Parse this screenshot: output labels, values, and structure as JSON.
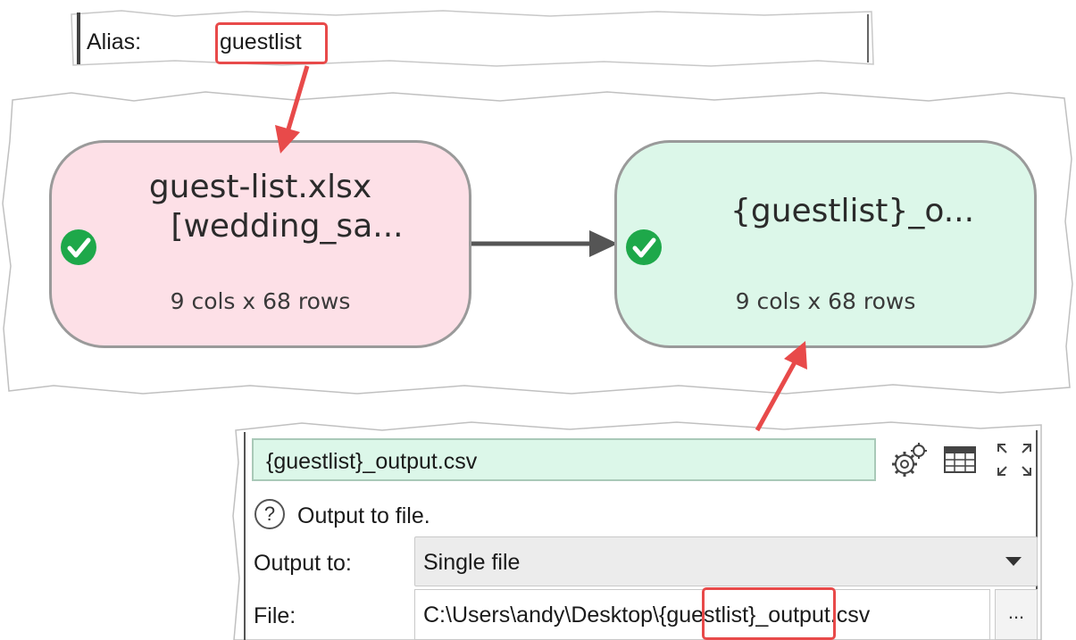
{
  "alias": {
    "label": "Alias:",
    "value": "guestlist"
  },
  "diagram": {
    "source_node": {
      "title_line1": "guest-list.xlsx",
      "title_line2": "[wedding_sa...",
      "subtitle": "9 cols x 68 rows",
      "status_icon": "check-circle-icon",
      "fill_color": "#fde0e7"
    },
    "output_node": {
      "title": "{guestlist}_o...",
      "subtitle": "9 cols x 68 rows",
      "status_icon": "check-circle-icon",
      "fill_color": "#dcf7e9"
    }
  },
  "properties": {
    "name_value": "{guestlist}_output.csv",
    "toolbar": {
      "settings_icon": "gears-icon",
      "table_icon": "table-icon",
      "expand_icon": "expand-icon"
    },
    "description": "Output to file.",
    "output_to": {
      "label": "Output to:",
      "value": "Single file"
    },
    "file": {
      "label": "File:",
      "value": "C:\\Users\\andy\\Desktop\\{guestlist}_output.csv",
      "browse_label": "..."
    }
  },
  "colors": {
    "highlight": "#e84a4a",
    "check_green": "#1ea84a",
    "edge": "#555555"
  }
}
